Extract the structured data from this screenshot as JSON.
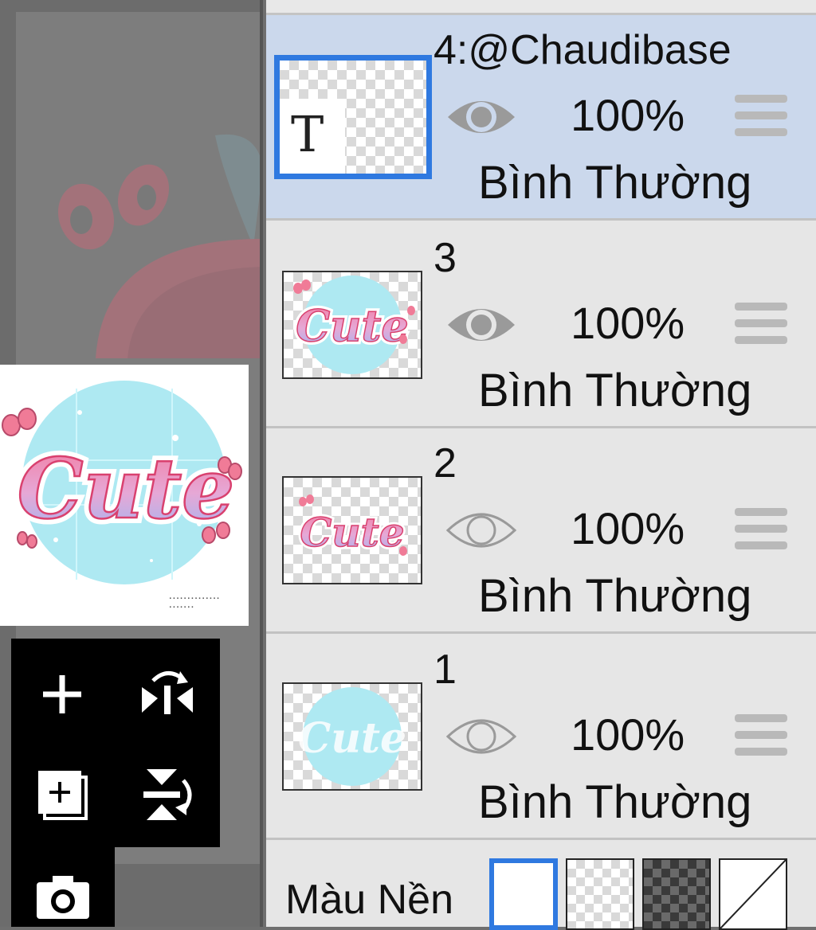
{
  "layers": [
    {
      "name": "4:@Chaudibase",
      "opacity": "100%",
      "blend_mode": "Bình Thường",
      "visible": true,
      "selected": true,
      "thumb_glyph": "T"
    },
    {
      "name": "3",
      "opacity": "100%",
      "blend_mode": "Bình Thường",
      "visible": true,
      "selected": false
    },
    {
      "name": "2",
      "opacity": "100%",
      "blend_mode": "Bình Thường",
      "visible": false,
      "selected": false
    },
    {
      "name": "1",
      "opacity": "100%",
      "blend_mode": "Bình Thường",
      "visible": false,
      "selected": false
    }
  ],
  "background": {
    "label": "Màu Nền",
    "options": [
      "white",
      "transparent",
      "dark-checker",
      "split-diagonal"
    ],
    "selected": "white"
  },
  "tools": [
    {
      "icon": "add-layer-icon"
    },
    {
      "icon": "flip-horizontal-icon"
    },
    {
      "icon": "duplicate-layer-icon"
    },
    {
      "icon": "flip-vertical-icon"
    },
    {
      "icon": "camera-icon"
    }
  ],
  "preview": {
    "artwork_text": "Cute"
  },
  "colors": {
    "selection_blue": "#2f79e0",
    "selected_row": "#cbd8ec",
    "cyan": "#aee9f2",
    "pink": "#f08aa6",
    "lilac": "#a9a6e0"
  }
}
